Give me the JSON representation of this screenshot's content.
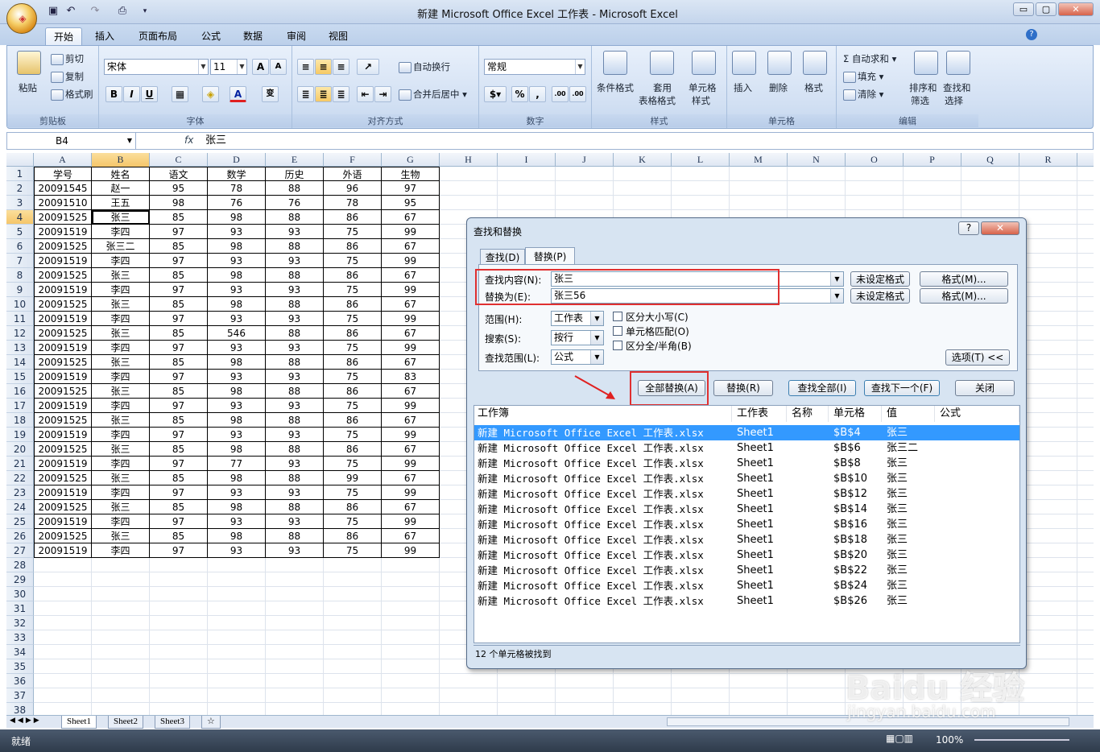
{
  "window": {
    "title": "新建 Microsoft Office Excel 工作表 - Microsoft Excel",
    "min": "▭",
    "max": "▢",
    "close": "✕"
  },
  "ribbon_tabs": [
    "开始",
    "插入",
    "页面布局",
    "公式",
    "数据",
    "审阅",
    "视图"
  ],
  "clipboard": {
    "paste": "粘贴",
    "cut": "剪切",
    "copy": "复制",
    "format_painter": "格式刷",
    "label": "剪贴板"
  },
  "font": {
    "name": "宋体",
    "size": "11",
    "grow": "A",
    "shrink": "A",
    "bold": "B",
    "italic": "I",
    "underline": "U",
    "color_letter": "A",
    "phonetic": "变",
    "label": "字体"
  },
  "alignment": {
    "wrap": "自动换行",
    "merge": "合并后居中",
    "label": "对齐方式"
  },
  "number": {
    "format": "常规",
    "percent": "%",
    "comma": ",",
    "inc": ".00",
    "dec": ".00",
    "label": "数字"
  },
  "styles": {
    "conditional": "条件格式",
    "table": "套用",
    "table2": "表格格式",
    "cell": "单元格",
    "cell2": "样式",
    "label": "样式"
  },
  "cells": {
    "insert": "插入",
    "delete": "删除",
    "format": "格式",
    "label": "单元格"
  },
  "editing": {
    "autosum": "自动求和",
    "fill": "填充",
    "clear": "清除",
    "sort": "排序和",
    "sort2": "筛选",
    "find": "查找和",
    "find2": "选择",
    "label": "编辑"
  },
  "formula_bar": {
    "cell_ref": "B4",
    "fx": "fx",
    "value": "张三"
  },
  "columns": [
    "A",
    "B",
    "C",
    "D",
    "E",
    "F",
    "G",
    "H",
    "I",
    "J",
    "K",
    "L",
    "M",
    "N",
    "O",
    "P",
    "Q",
    "R"
  ],
  "rows": [
    "1",
    "2",
    "3",
    "4",
    "5",
    "6",
    "7",
    "8",
    "9",
    "10",
    "11",
    "12",
    "13",
    "14",
    "15",
    "16",
    "17",
    "18",
    "19",
    "20",
    "21",
    "22",
    "23",
    "24",
    "25",
    "26",
    "27",
    "28",
    "29",
    "30",
    "31",
    "32",
    "33",
    "34",
    "35",
    "36",
    "37",
    "38"
  ],
  "table": [
    [
      "学号",
      "姓名",
      "语文",
      "数学",
      "历史",
      "外语",
      "生物"
    ],
    [
      "20091545",
      "赵一",
      "95",
      "78",
      "88",
      "96",
      "97"
    ],
    [
      "20091510",
      "王五",
      "98",
      "76",
      "76",
      "78",
      "95"
    ],
    [
      "20091525",
      "张三",
      "85",
      "98",
      "88",
      "86",
      "67"
    ],
    [
      "20091519",
      "李四",
      "97",
      "93",
      "93",
      "75",
      "99"
    ],
    [
      "20091525",
      "张三二",
      "85",
      "98",
      "88",
      "86",
      "67"
    ],
    [
      "20091519",
      "李四",
      "97",
      "93",
      "93",
      "75",
      "99"
    ],
    [
      "20091525",
      "张三",
      "85",
      "98",
      "88",
      "86",
      "67"
    ],
    [
      "20091519",
      "李四",
      "97",
      "93",
      "93",
      "75",
      "99"
    ],
    [
      "20091525",
      "张三",
      "85",
      "98",
      "88",
      "86",
      "67"
    ],
    [
      "20091519",
      "李四",
      "97",
      "93",
      "93",
      "75",
      "99"
    ],
    [
      "20091525",
      "张三",
      "85",
      "546",
      "88",
      "86",
      "67"
    ],
    [
      "20091519",
      "李四",
      "97",
      "93",
      "93",
      "75",
      "99"
    ],
    [
      "20091525",
      "张三",
      "85",
      "98",
      "88",
      "86",
      "67"
    ],
    [
      "20091519",
      "李四",
      "97",
      "93",
      "93",
      "75",
      "83"
    ],
    [
      "20091525",
      "张三",
      "85",
      "98",
      "88",
      "86",
      "67"
    ],
    [
      "20091519",
      "李四",
      "97",
      "93",
      "93",
      "75",
      "99"
    ],
    [
      "20091525",
      "张三",
      "85",
      "98",
      "88",
      "86",
      "67"
    ],
    [
      "20091519",
      "李四",
      "97",
      "93",
      "93",
      "75",
      "99"
    ],
    [
      "20091525",
      "张三",
      "85",
      "98",
      "88",
      "86",
      "67"
    ],
    [
      "20091519",
      "李四",
      "97",
      "77",
      "93",
      "75",
      "99"
    ],
    [
      "20091525",
      "张三",
      "85",
      "98",
      "88",
      "99",
      "67"
    ],
    [
      "20091519",
      "李四",
      "97",
      "93",
      "93",
      "75",
      "99"
    ],
    [
      "20091525",
      "张三",
      "85",
      "98",
      "88",
      "86",
      "67"
    ],
    [
      "20091519",
      "李四",
      "97",
      "93",
      "93",
      "75",
      "99"
    ],
    [
      "20091525",
      "张三",
      "85",
      "98",
      "88",
      "86",
      "67"
    ],
    [
      "20091519",
      "李四",
      "97",
      "93",
      "93",
      "75",
      "99"
    ]
  ],
  "sheet_tabs": [
    "Sheet1",
    "Sheet2",
    "Sheet3"
  ],
  "status": {
    "ready": "就绪",
    "zoom": "100%"
  },
  "dialog": {
    "title": "查找和替换",
    "help": "?",
    "close": "✕",
    "tab_find": "查找(D)",
    "tab_replace": "替换(P)",
    "find_label": "查找内容(N):",
    "find_value": "张三",
    "replace_label": "替换为(E):",
    "replace_value": "张三56",
    "no_format": "未设定格式",
    "format_btn": "格式(M)...",
    "within_label": "范围(H):",
    "within_value": "工作表",
    "search_label": "搜索(S):",
    "search_value": "按行",
    "lookin_label": "查找范围(L):",
    "lookin_value": "公式",
    "match_case": "区分大小写(C)",
    "match_cell": "单元格匹配(O)",
    "match_width": "区分全/半角(B)",
    "options": "选项(T) <<",
    "replace_all": "全部替换(A)",
    "replace": "替换(R)",
    "find_all": "查找全部(I)",
    "find_next": "查找下一个(F)",
    "close_btn": "关闭",
    "result_headers": [
      "工作簿",
      "工作表",
      "名称",
      "单元格",
      "值",
      "公式"
    ],
    "results": [
      {
        "book": "新建 Microsoft Office Excel 工作表.xlsx",
        "sheet": "Sheet1",
        "cell": "$B$4",
        "value": "张三"
      },
      {
        "book": "新建 Microsoft Office Excel 工作表.xlsx",
        "sheet": "Sheet1",
        "cell": "$B$6",
        "value": "张三二"
      },
      {
        "book": "新建 Microsoft Office Excel 工作表.xlsx",
        "sheet": "Sheet1",
        "cell": "$B$8",
        "value": "张三"
      },
      {
        "book": "新建 Microsoft Office Excel 工作表.xlsx",
        "sheet": "Sheet1",
        "cell": "$B$10",
        "value": "张三"
      },
      {
        "book": "新建 Microsoft Office Excel 工作表.xlsx",
        "sheet": "Sheet1",
        "cell": "$B$12",
        "value": "张三"
      },
      {
        "book": "新建 Microsoft Office Excel 工作表.xlsx",
        "sheet": "Sheet1",
        "cell": "$B$14",
        "value": "张三"
      },
      {
        "book": "新建 Microsoft Office Excel 工作表.xlsx",
        "sheet": "Sheet1",
        "cell": "$B$16",
        "value": "张三"
      },
      {
        "book": "新建 Microsoft Office Excel 工作表.xlsx",
        "sheet": "Sheet1",
        "cell": "$B$18",
        "value": "张三"
      },
      {
        "book": "新建 Microsoft Office Excel 工作表.xlsx",
        "sheet": "Sheet1",
        "cell": "$B$20",
        "value": "张三"
      },
      {
        "book": "新建 Microsoft Office Excel 工作表.xlsx",
        "sheet": "Sheet1",
        "cell": "$B$22",
        "value": "张三"
      },
      {
        "book": "新建 Microsoft Office Excel 工作表.xlsx",
        "sheet": "Sheet1",
        "cell": "$B$24",
        "value": "张三"
      },
      {
        "book": "新建 Microsoft Office Excel 工作表.xlsx",
        "sheet": "Sheet1",
        "cell": "$B$26",
        "value": "张三"
      }
    ],
    "status": "12 个单元格被找到"
  },
  "watermark": {
    "line1": "Baidu 经验",
    "line2": "jingyan.baidu.com"
  },
  "colors": {
    "selection": "#3399ff",
    "highlight_box": "#e03030",
    "active_header": "#f8d47f"
  }
}
